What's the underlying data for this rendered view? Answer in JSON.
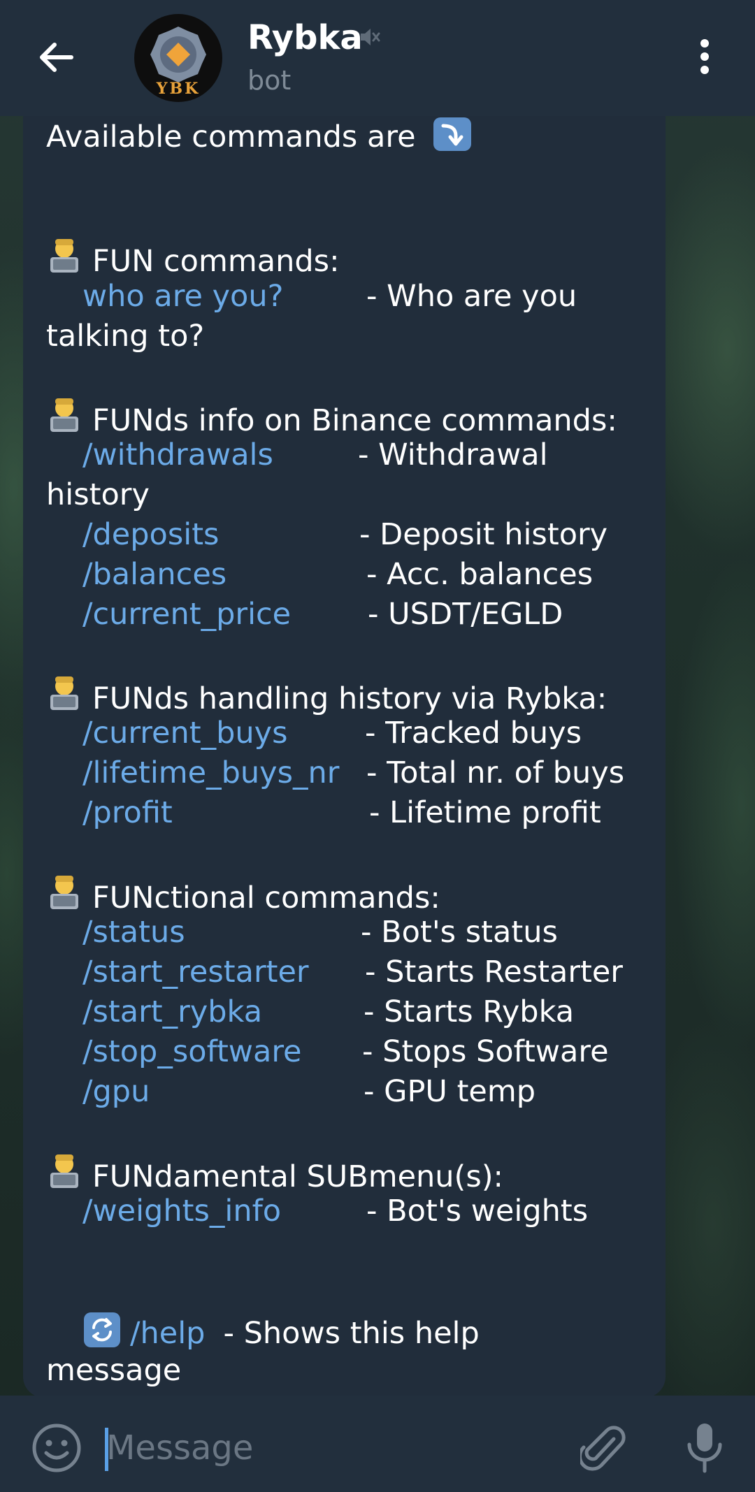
{
  "header": {
    "title": "Rybka",
    "subtitle": "bot",
    "avatar_text": "YBK"
  },
  "message": {
    "intro": "Available commands are",
    "sections": [
      {
        "heading": "FUN commands:",
        "rows": [
          {
            "command": "who are you?",
            "description": "- Who are you",
            "continuation": "talking to?"
          }
        ]
      },
      {
        "heading": "FUNds info on Binance commands:",
        "rows": [
          {
            "command": "/withdrawals",
            "description": "- Withdrawal",
            "continuation": "history"
          },
          {
            "command": "/deposits",
            "description": "- Deposit history"
          },
          {
            "command": "/balances",
            "description": "- Acc. balances"
          },
          {
            "command": "/current_price",
            "description": "- USDT/EGLD"
          }
        ]
      },
      {
        "heading": "FUNds handling history via Rybka:",
        "rows": [
          {
            "command": "/current_buys",
            "description": "- Tracked buys"
          },
          {
            "command": "/lifetime_buys_nr",
            "description": "- Total nr. of buys"
          },
          {
            "command": "/profit",
            "description": "- Lifetime profit"
          }
        ]
      },
      {
        "heading": "FUNctional commands:",
        "rows": [
          {
            "command": "/status",
            "description": "- Bot's status"
          },
          {
            "command": "/start_restarter",
            "description": "- Starts Restarter"
          },
          {
            "command": "/start_rybka",
            "description": "- Starts Rybka"
          },
          {
            "command": "/stop_software",
            "description": "- Stops Software"
          },
          {
            "command": "/gpu",
            "description": "- GPU temp"
          }
        ]
      },
      {
        "heading": "FUNdamental SUBmenu(s):",
        "rows": [
          {
            "command": "/weights_info",
            "description": "- Bot's weights"
          }
        ]
      }
    ],
    "help": {
      "command": "/help",
      "description": "-  Shows this help",
      "continuation": "message"
    }
  },
  "input": {
    "placeholder": "Message"
  },
  "icons": {
    "back": "arrow-left-icon",
    "mute": "mute-icon",
    "menu": "more-vertical-icon",
    "emoji": "smiley-icon",
    "attach": "paperclip-icon",
    "mic": "microphone-icon",
    "section_emoji": "technologist-emoji",
    "intro_emoji": "arrow-down-emoji",
    "help_emoji": "refresh-emoji"
  },
  "colors": {
    "header_bg": "#222f3d",
    "bubble_bg": "#212d3b",
    "command_link": "#6cabe8",
    "text": "#ffffff",
    "muted": "#7f8b97"
  }
}
